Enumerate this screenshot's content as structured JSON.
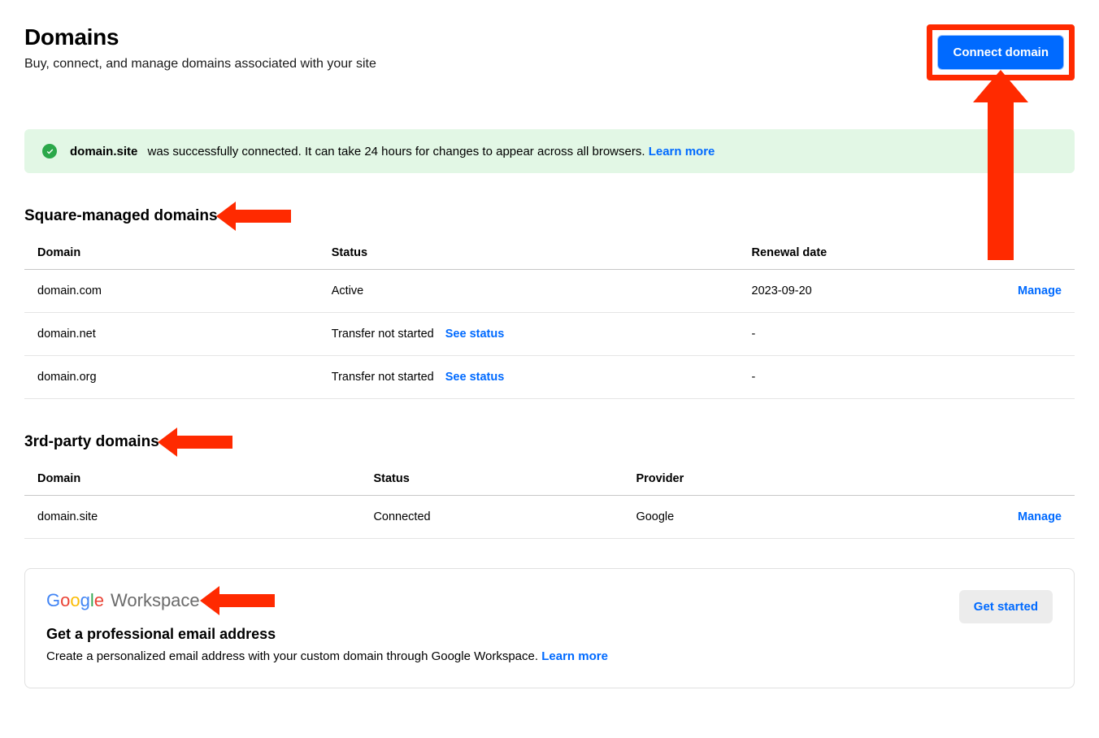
{
  "header": {
    "title": "Domains",
    "subtitle": "Buy, connect, and manage domains associated with your site",
    "connect_label": "Connect domain"
  },
  "alert": {
    "domain": "domain.site",
    "message": "was successfully connected. It can take 24 hours for changes to appear across all browsers.",
    "learn_more": "Learn more"
  },
  "sections": {
    "square": {
      "title": "Square-managed domains",
      "columns": {
        "domain": "Domain",
        "status": "Status",
        "renewal": "Renewal date"
      },
      "rows": [
        {
          "domain": "domain.com",
          "status": "Active",
          "see_status": "",
          "renewal": "2023-09-20",
          "action": "Manage"
        },
        {
          "domain": "domain.net",
          "status": "Transfer not started",
          "see_status": "See status",
          "renewal": "-",
          "action": ""
        },
        {
          "domain": "domain.org",
          "status": "Transfer not started",
          "see_status": "See status",
          "renewal": "-",
          "action": ""
        }
      ]
    },
    "third_party": {
      "title": "3rd-party domains",
      "columns": {
        "domain": "Domain",
        "status": "Status",
        "provider": "Provider"
      },
      "rows": [
        {
          "domain": "domain.site",
          "status": "Connected",
          "provider": "Google",
          "action": "Manage"
        }
      ]
    }
  },
  "workspace_card": {
    "logo_google": "Google",
    "logo_workspace": "Workspace",
    "heading": "Get a professional email address",
    "body": "Create a personalized email address with your custom domain through Google Workspace.",
    "learn_more": "Learn more",
    "cta": "Get started"
  }
}
